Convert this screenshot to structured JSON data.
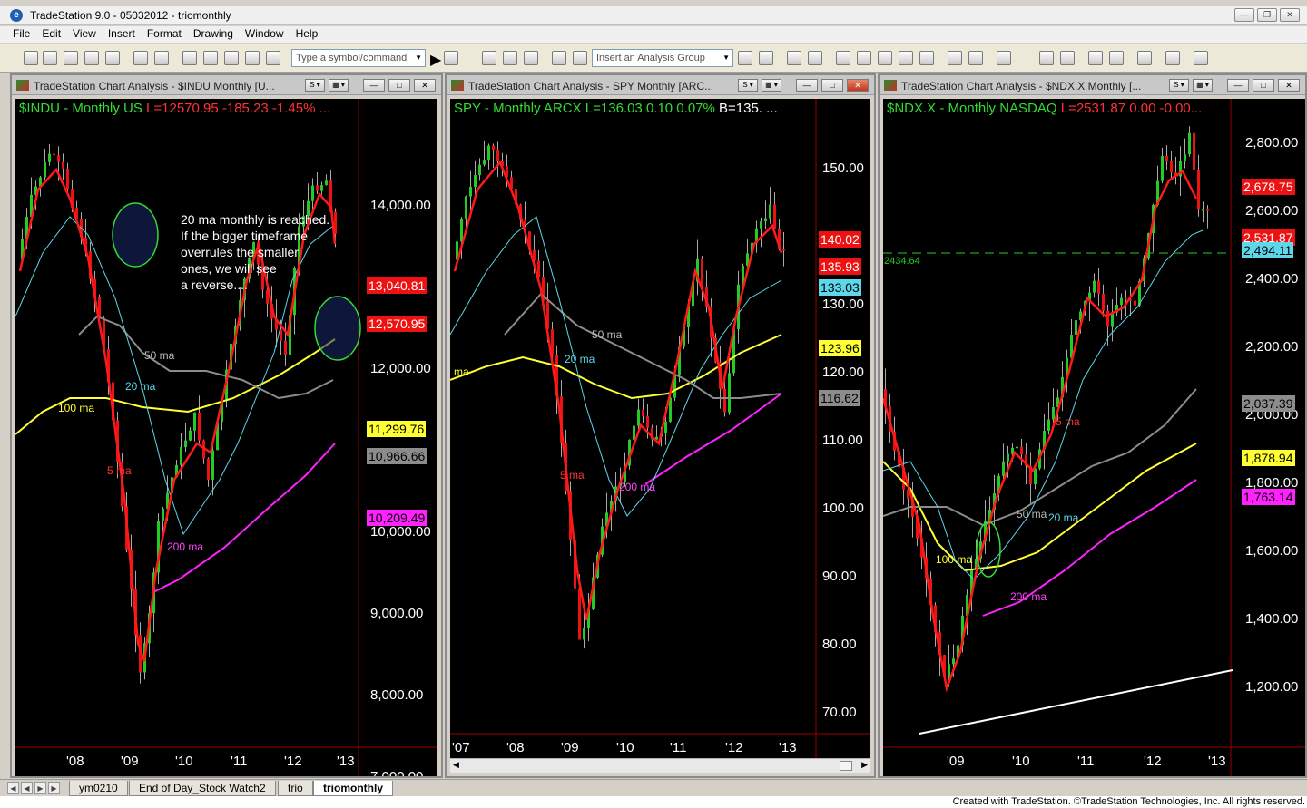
{
  "window": {
    "title": "TradeStation 9.0 - 05032012 - triomonthly"
  },
  "menu": [
    "File",
    "Edit",
    "View",
    "Insert",
    "Format",
    "Drawing",
    "Window",
    "Help"
  ],
  "toolbar": {
    "symbol_placeholder": "Type a symbol/command",
    "analysis_group_placeholder": "Insert an Analysis Group"
  },
  "colors": {
    "background": "#000000",
    "bull": "#22cc22",
    "bear": "#ee1111",
    "ma5": "#ff1a1a",
    "ma20": "#5fd7ea",
    "ma50": "#8c8c8c",
    "ma100": "#ffff33",
    "ma200": "#ff22ff",
    "grid": "#111111",
    "axis_line": "#990000"
  },
  "charts": [
    {
      "id": "indu",
      "window_title": "TradeStation Chart Analysis - $INDU Monthly [U...",
      "header": {
        "symbol": "$INDU - Monthly  US",
        "last": "L=12570.95  -185.23  -1.45%  ..."
      },
      "price_labels": [
        "14,000.00",
        "12,000.00",
        "10,000.00",
        "9,000.00",
        "8,000.00",
        "7,000.00"
      ],
      "date_labels": [
        "'08",
        "'09",
        "'10",
        "'11",
        "'12",
        "'13"
      ],
      "tags": [
        {
          "text": "13,040.81",
          "color": "#ee1111",
          "fg": "#ffffff"
        },
        {
          "text": "12,570.95",
          "color": "#ee1111",
          "fg": "#ffffff"
        },
        {
          "text": "11,299.76",
          "color": "#ffff33",
          "fg": "#000000"
        },
        {
          "text": "10,966.66",
          "color": "#8c8c8c",
          "fg": "#000000"
        },
        {
          "text": "10,209.49",
          "color": "#ff22ff",
          "fg": "#000000"
        }
      ],
      "ma_labels": {
        "ma50": "50 ma",
        "ma20": "20 ma",
        "ma100": "100 ma",
        "ma5": "5 ma",
        "ma200": "200 ma"
      },
      "note": [
        "20 ma monthly is reached.",
        "If the bigger timeframe",
        "overrules the smaller",
        "ones, we will see",
        "a reverse...."
      ]
    },
    {
      "id": "spy",
      "window_title": "TradeStation Chart Analysis - SPY Monthly [ARC...",
      "header": {
        "symbol": "SPY - Monthly  ARCX",
        "last": "L=136.03  0.10  0.07%",
        "extra": "B=135. ..."
      },
      "price_labels": [
        "150.00",
        "130.00",
        "120.00",
        "110.00",
        "100.00",
        "90.00",
        "80.00",
        "70.00"
      ],
      "date_labels": [
        "'07",
        "'08",
        "'09",
        "'10",
        "'11",
        "'12",
        "'13"
      ],
      "tags": [
        {
          "text": "140.02",
          "color": "#ee1111",
          "fg": "#ffffff"
        },
        {
          "text": "135.93",
          "color": "#ee1111",
          "fg": "#ffffff"
        },
        {
          "text": "133.03",
          "color": "#5fd7ea",
          "fg": "#000000"
        },
        {
          "text": "123.96",
          "color": "#ffff33",
          "fg": "#000000"
        },
        {
          "text": "116.62",
          "color": "#8c8c8c",
          "fg": "#000000"
        }
      ],
      "ma_labels": {
        "ma50": "50 ma",
        "ma20": "20 ma",
        "ma100": "ma",
        "ma5": "5 ma",
        "ma200": "200 ma"
      }
    },
    {
      "id": "ndx",
      "window_title": "TradeStation Chart Analysis - $NDX.X Monthly [...",
      "header": {
        "symbol": "$NDX.X - Monthly  NASDAQ",
        "last": "L=2531.87  0.00  -0.00..."
      },
      "price_labels": [
        "2,800.00",
        "2,600.00",
        "2,400.00",
        "2,200.00",
        "2,000.00",
        "1,800.00",
        "1,600.00",
        "1,400.00",
        "1,200.00"
      ],
      "date_labels": [
        "'09",
        "'10",
        "'11",
        "'12",
        "'13"
      ],
      "tags": [
        {
          "text": "2,678.75",
          "color": "#ee1111",
          "fg": "#ffffff"
        },
        {
          "text": "2,531.87",
          "color": "#ee1111",
          "fg": "#ffffff"
        },
        {
          "text": "2,494.11",
          "color": "#5fd7ea",
          "fg": "#000000"
        },
        {
          "text": "2,037.39",
          "color": "#8c8c8c",
          "fg": "#000000"
        },
        {
          "text": "1,878.94",
          "color": "#ffff33",
          "fg": "#000000"
        },
        {
          "text": "1,763.14",
          "color": "#ff22ff",
          "fg": "#000000"
        }
      ],
      "hline_label": "2434.64",
      "ma_labels": {
        "ma50": "50 ma",
        "ma20": "20 ma",
        "ma100": "100 ma",
        "ma5": "5 ma",
        "ma200": "200 ma"
      }
    }
  ],
  "tabs": [
    "ym0210",
    "End of Day_Stock Watch2",
    "trio",
    "triomonthly"
  ],
  "active_tab": "triomonthly",
  "status": {
    "credit": "Created with TradeStation. ©TradeStation Technologies, Inc. All rights reserved."
  }
}
